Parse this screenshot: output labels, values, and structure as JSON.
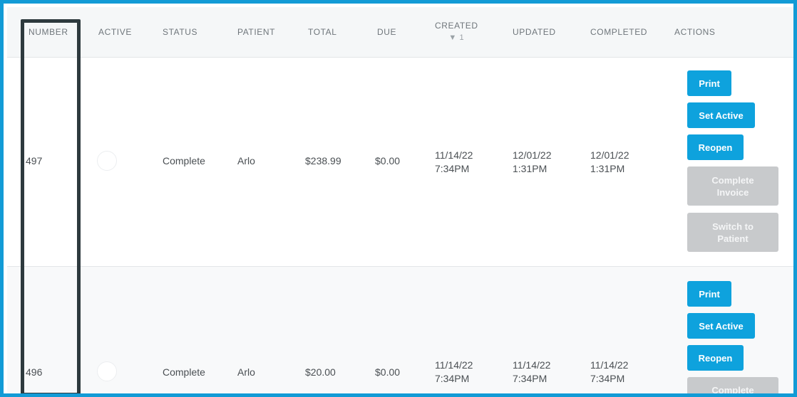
{
  "table": {
    "columns": {
      "number": "NUMBER",
      "active": "ACTIVE",
      "status": "STATUS",
      "patient": "PATIENT",
      "total": "TOTAL",
      "due": "DUE",
      "created": "CREATED",
      "created_sort": "▼ 1",
      "updated": "UPDATED",
      "completed": "COMPLETED",
      "actions": "ACTIONS"
    },
    "rows": [
      {
        "number": "497",
        "status": "Complete",
        "patient": "Arlo",
        "total": "$238.99",
        "due": "$0.00",
        "created_date": "11/14/22",
        "created_time": "7:34PM",
        "updated_date": "12/01/22",
        "updated_time": "1:31PM",
        "completed_date": "12/01/22",
        "completed_time": "1:31PM",
        "actions": {
          "print": "Print",
          "set_active": "Set Active",
          "reopen": "Reopen",
          "complete_invoice_1": "Complete",
          "complete_invoice_2": "Invoice",
          "switch_patient_1": "Switch to",
          "switch_patient_2": "Patient"
        }
      },
      {
        "number": "496",
        "status": "Complete",
        "patient": "Arlo",
        "total": "$20.00",
        "due": "$0.00",
        "created_date": "11/14/22",
        "created_time": "7:34PM",
        "updated_date": "11/14/22",
        "updated_time": "7:34PM",
        "completed_date": "11/14/22",
        "completed_time": "7:34PM",
        "actions": {
          "print": "Print",
          "set_active": "Set Active",
          "reopen": "Reopen",
          "complete_invoice_1": "Complete"
        }
      }
    ]
  },
  "colors": {
    "frame_border": "#129bd6",
    "button_primary": "#0ea2dd",
    "button_disabled": "#c8cacc",
    "highlight_box": "#2e3a3e"
  },
  "icons": {
    "active_toggle": "radio-circle",
    "sort": "sort-down-triangle"
  }
}
